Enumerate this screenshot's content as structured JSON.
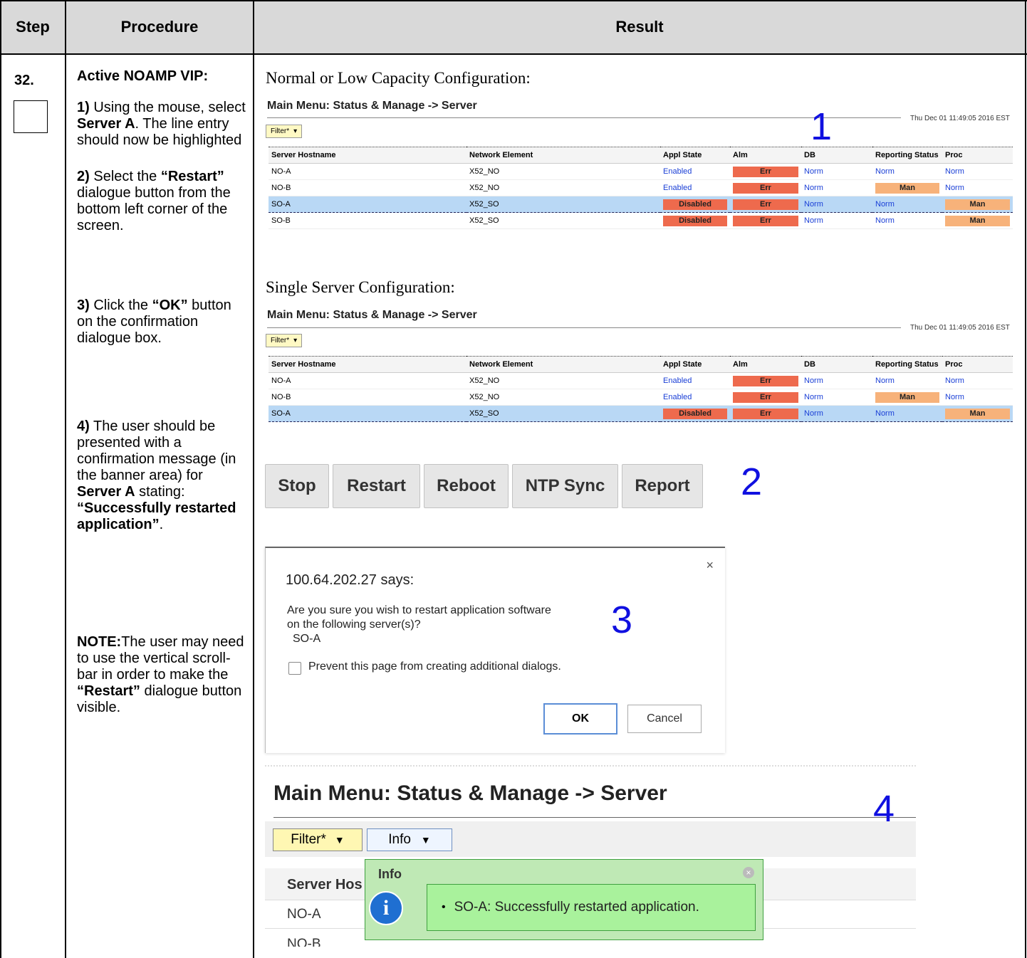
{
  "header": {
    "step": "Step",
    "procedure": "Procedure",
    "result": "Result"
  },
  "step_number": "32.",
  "procedure": {
    "heading": "Active NOAMP VIP:",
    "s1_num": "1)",
    "s1_a": " Using the mouse, select ",
    "s1_b": "Server A",
    "s1_c": ". The line entry should now be highlighted",
    "s2_num": "2)",
    "s2_a": " Select the ",
    "s2_b": "“Restart”",
    "s2_c": " dialogue button from the bottom left corner of the screen.",
    "s3_num": "3)",
    "s3_a": " Click the ",
    "s3_b": "“OK”",
    "s3_c": " button on the confirmation dialogue box.",
    "s4_num": "4)",
    "s4_a": " The user should be presented with a confirmation message (in the banner area) for ",
    "s4_b": "Server A",
    "s4_c": " stating: ",
    "s4_d": "“Successfully restarted application”",
    "s4_e": ".",
    "note_label": "NOTE:",
    "note_a": "The user may need to use the vertical scroll-bar in order to make the ",
    "note_b": "“Restart”",
    "note_c": " dialogue button visible."
  },
  "result": {
    "caption1": "Normal or Low Capacity Configuration:",
    "caption2": "Single Server Configuration:",
    "screen_title": "Main Menu: Status & Manage -> Server",
    "timestamp": "Thu Dec 01 11:49:05 2016 EST",
    "filter_label": "Filter*",
    "columns": [
      "Server Hostname",
      "Network Element",
      "Appl State",
      "Alm",
      "DB",
      "Reporting Status",
      "Proc"
    ],
    "rows": [
      [
        "NO-A",
        "X52_NO",
        "Enabled",
        "Err",
        "Norm",
        "Norm",
        "Norm"
      ],
      [
        "NO-B",
        "X52_NO",
        "Enabled",
        "Err",
        "Norm",
        "Man",
        "Norm"
      ],
      [
        "SO-A",
        "X52_SO",
        "Disabled",
        "Err",
        "Norm",
        "Norm",
        "Man"
      ],
      [
        "SO-B",
        "X52_SO",
        "Disabled",
        "Err",
        "Norm",
        "Norm",
        "Man"
      ]
    ],
    "marker1": "1",
    "marker2": "2",
    "marker3": "3",
    "marker4": "4",
    "buttons": [
      "Stop",
      "Restart",
      "Reboot",
      "NTP Sync",
      "Report"
    ],
    "dialog": {
      "title": "100.64.202.27 says:",
      "line1": "Are you sure you wish to restart application software",
      "line2": "on the following server(s)?",
      "line3": "SO-A",
      "checkbox": "Prevent this page from creating additional dialogs.",
      "ok": "OK",
      "cancel": "Cancel",
      "close": "×"
    },
    "bottom": {
      "filter": "Filter*",
      "info": "Info",
      "info_title": "Info",
      "info_message": "SO-A: Successfully restarted application.",
      "col1": "Server Hos",
      "row1": "NO-A",
      "row2": "NO-B"
    }
  }
}
